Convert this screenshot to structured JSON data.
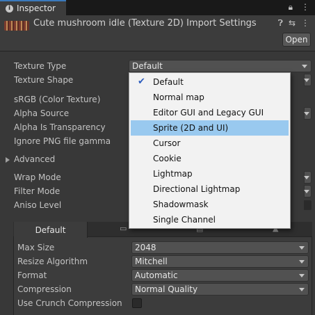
{
  "tab": {
    "title": "Inspector",
    "icon": "info-icon"
  },
  "header": {
    "title": "Cute mushroom idle (Texture 2D) Import Settings",
    "open_label": "Open"
  },
  "properties": {
    "texture_type": {
      "label": "Texture Type",
      "value": "Default"
    },
    "texture_shape": {
      "label": "Texture Shape"
    },
    "srgb": {
      "label": "sRGB (Color Texture)"
    },
    "alpha_source": {
      "label": "Alpha Source"
    },
    "alpha_transparency": {
      "label": "Alpha Is Transparency"
    },
    "ignore_png": {
      "label": "Ignore PNG file gamma"
    },
    "advanced": {
      "label": "Advanced"
    },
    "wrap_mode": {
      "label": "Wrap Mode"
    },
    "filter_mode": {
      "label": "Filter Mode"
    },
    "aniso_level": {
      "label": "Aniso Level"
    }
  },
  "dropdown": {
    "options": [
      "Default",
      "Normal map",
      "Editor GUI and Legacy GUI",
      "Sprite (2D and UI)",
      "Cursor",
      "Cookie",
      "Lightmap",
      "Directional Lightmap",
      "Shadowmask",
      "Single Channel"
    ],
    "checked": "Default",
    "highlighted": "Sprite (2D and UI)"
  },
  "platform": {
    "active_tab": "Default",
    "max_size": {
      "label": "Max Size",
      "value": "2048"
    },
    "resize": {
      "label": "Resize Algorithm",
      "value": "Mitchell"
    },
    "format": {
      "label": "Format",
      "value": "Automatic"
    },
    "compression": {
      "label": "Compression",
      "value": "Normal Quality"
    },
    "crunch": {
      "label": "Use Crunch Compression",
      "checked": false
    }
  }
}
